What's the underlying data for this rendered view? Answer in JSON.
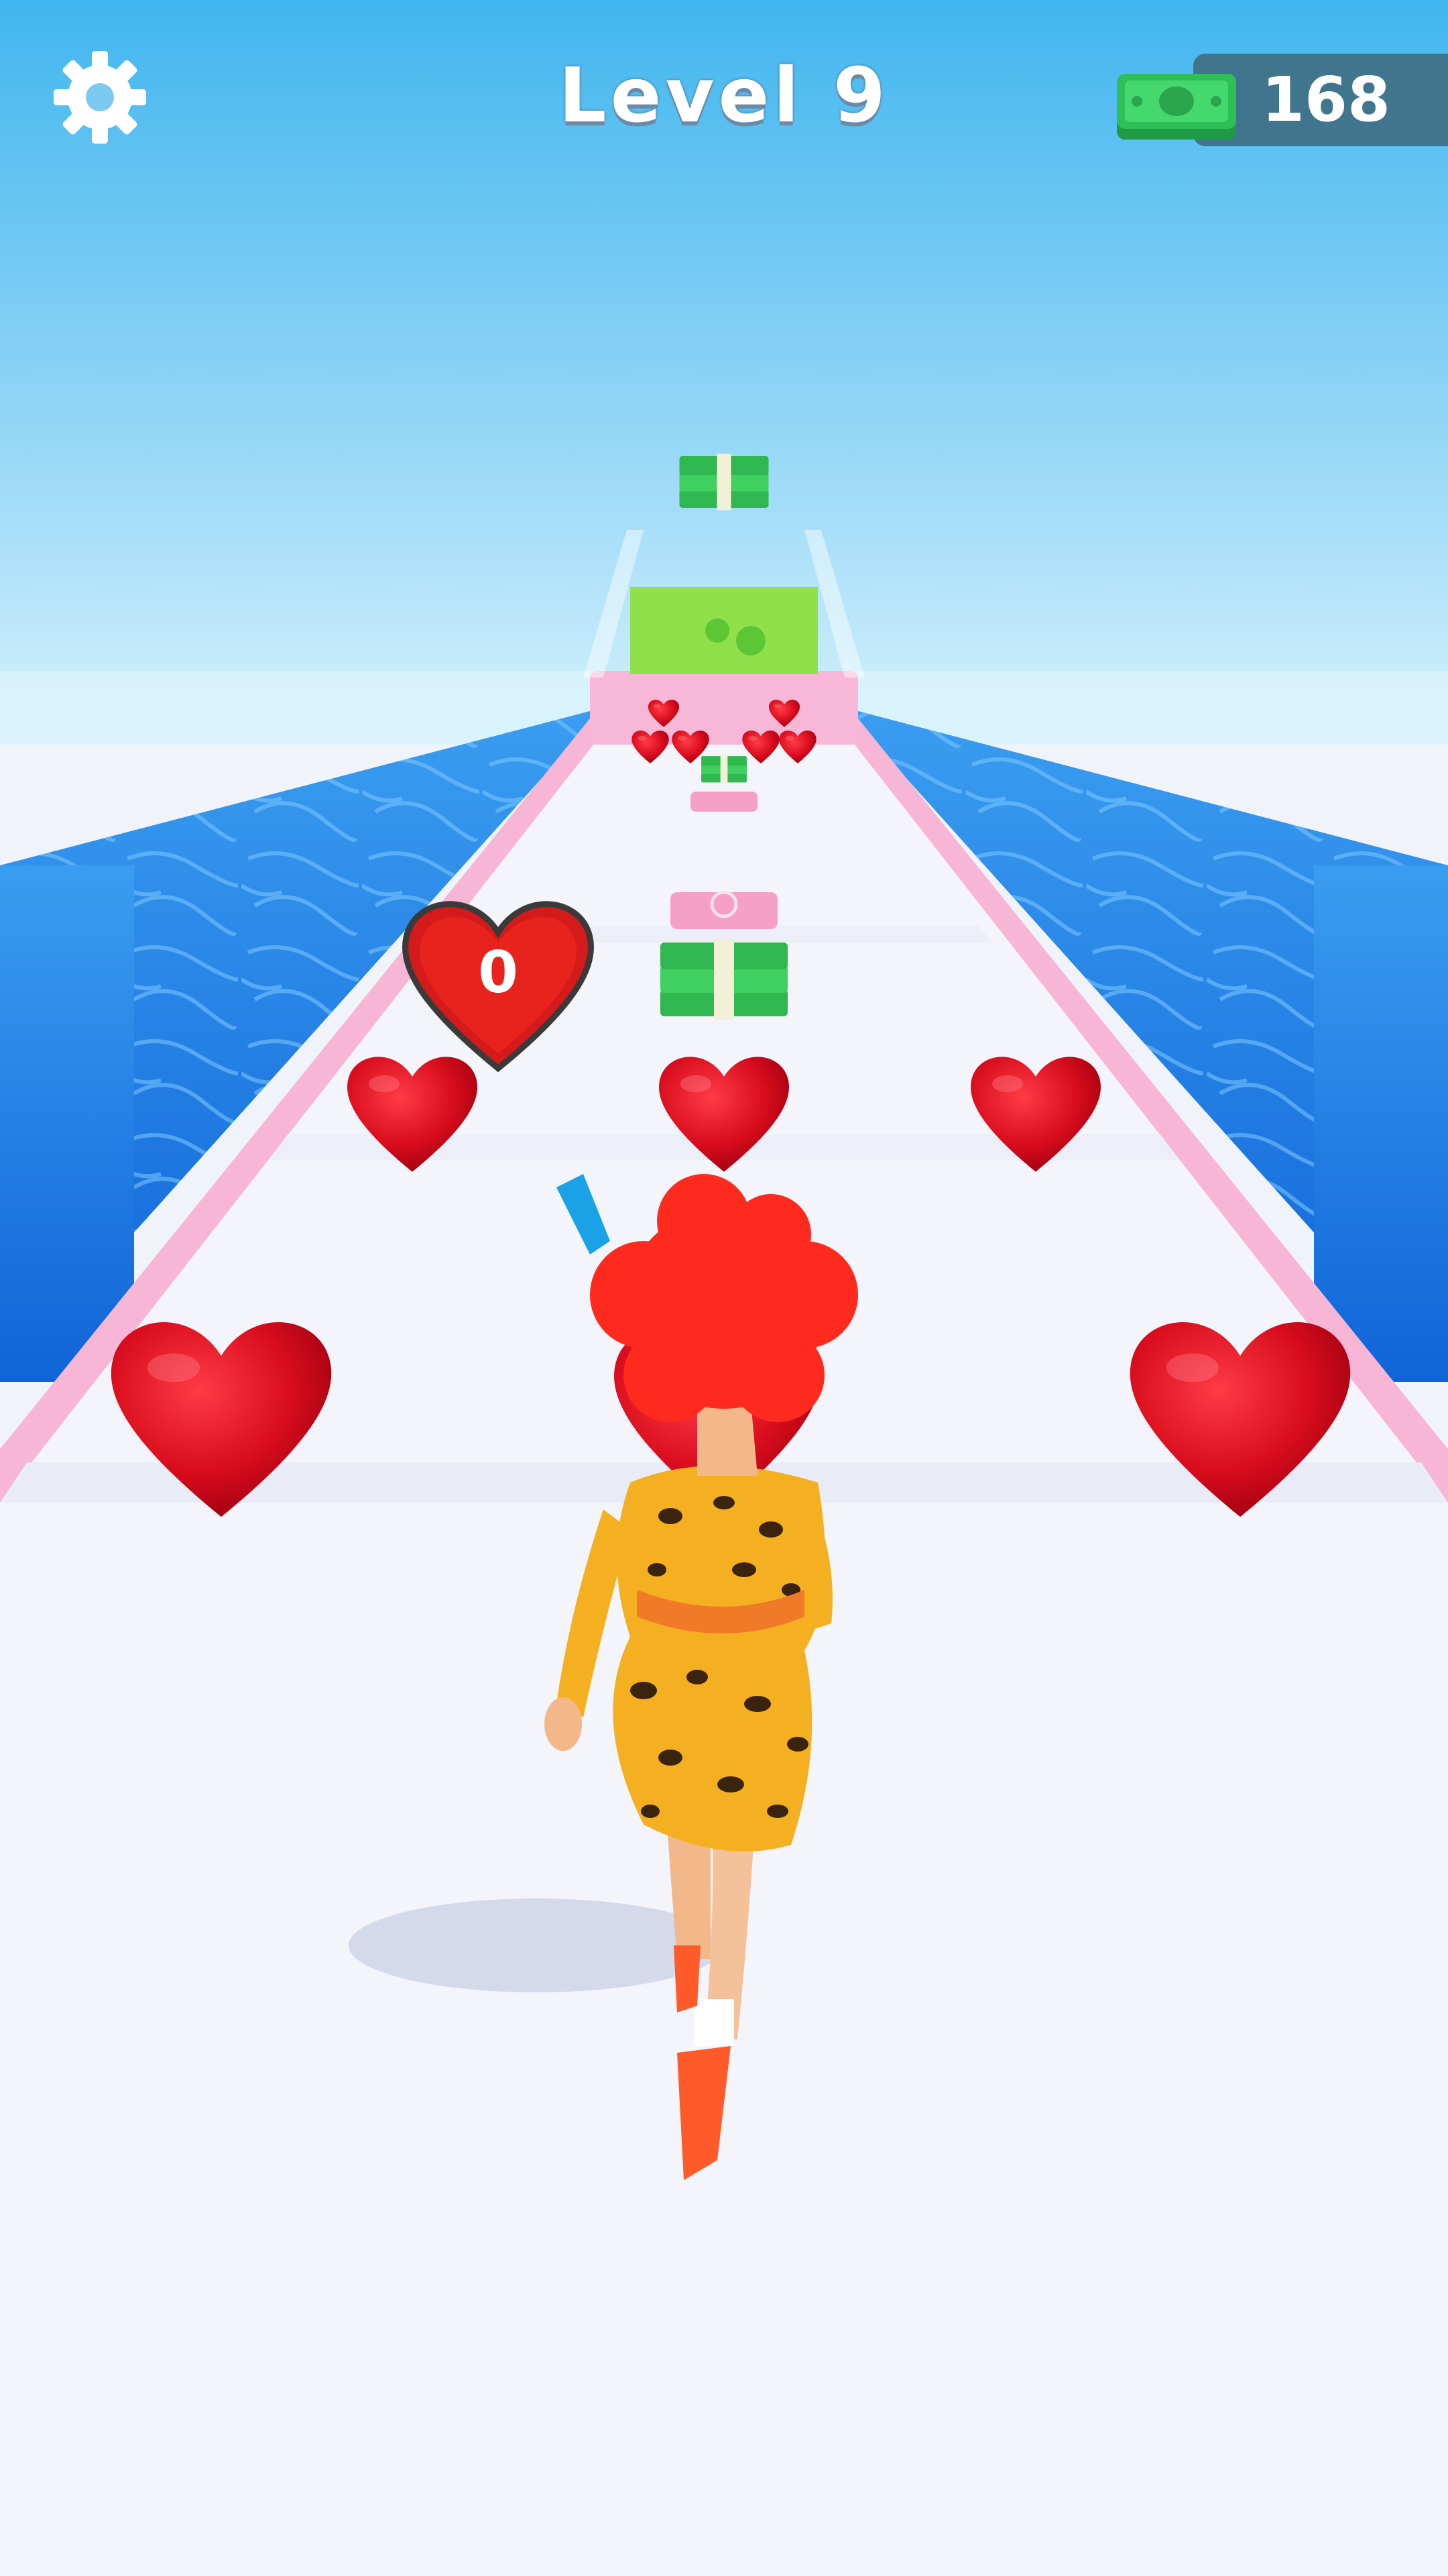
{
  "hud": {
    "level_label": "Level 9",
    "cash_amount": "168",
    "settings_icon": "gear-icon",
    "cash_icon": "banknote-stack-icon"
  },
  "track": {
    "heart_badge_count": "0"
  },
  "colors": {
    "sky_top": "#3fb7f0",
    "sky_bottom": "#bfe9fb",
    "water": "#1a78e0",
    "track": "#f4f5fb",
    "track_border": "#f7b6d6",
    "heart": "#e01020",
    "cash_green": "#33c45a",
    "hud_panel": "#3f6f86"
  }
}
